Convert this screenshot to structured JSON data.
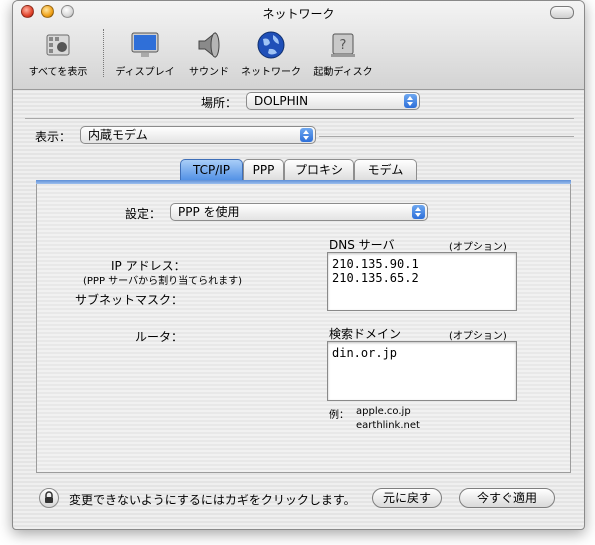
{
  "window": {
    "title": "ネットワーク"
  },
  "toolbar": {
    "items": [
      {
        "label": "すべてを表示",
        "icon": "apple-prefs-icon"
      },
      {
        "label": "ディスプレイ",
        "icon": "display-icon"
      },
      {
        "label": "サウンド",
        "icon": "speaker-icon"
      },
      {
        "label": "ネットワーク",
        "icon": "globe-icon"
      },
      {
        "label": "起動ディスク",
        "icon": "disk-icon"
      }
    ]
  },
  "location": {
    "label": "場所：",
    "value": "DOLPHIN"
  },
  "show": {
    "label": "表示：",
    "value": "内蔵モデム"
  },
  "tabs": [
    {
      "label": "TCP/IP",
      "active": true
    },
    {
      "label": "PPP",
      "active": false
    },
    {
      "label": "プロキシ",
      "active": false
    },
    {
      "label": "モデム",
      "active": false
    }
  ],
  "tcpip": {
    "config_label": "設定：",
    "config_value": "PPP を使用",
    "ip_label": "IP アドレス：",
    "ip_note": "(PPP サーバから割り当てられます)",
    "subnet_label": "サブネットマスク：",
    "router_label": "ルータ：",
    "dns_label": "DNS サーバ",
    "dns_optional": "(オプション)",
    "dns_servers": [
      "210.135.90.1",
      "210.135.65.2"
    ],
    "search_label": "検索ドメイン",
    "search_optional": "(オプション)",
    "search_domains": [
      "din.or.jp"
    ],
    "example_label": "例：",
    "example_values": [
      "apple.co.jp",
      "earthlink.net"
    ]
  },
  "footer": {
    "lock_text": "変更できないようにするにはカギをクリックします。",
    "revert_label": "元に戻す",
    "apply_label": "今すぐ適用"
  }
}
